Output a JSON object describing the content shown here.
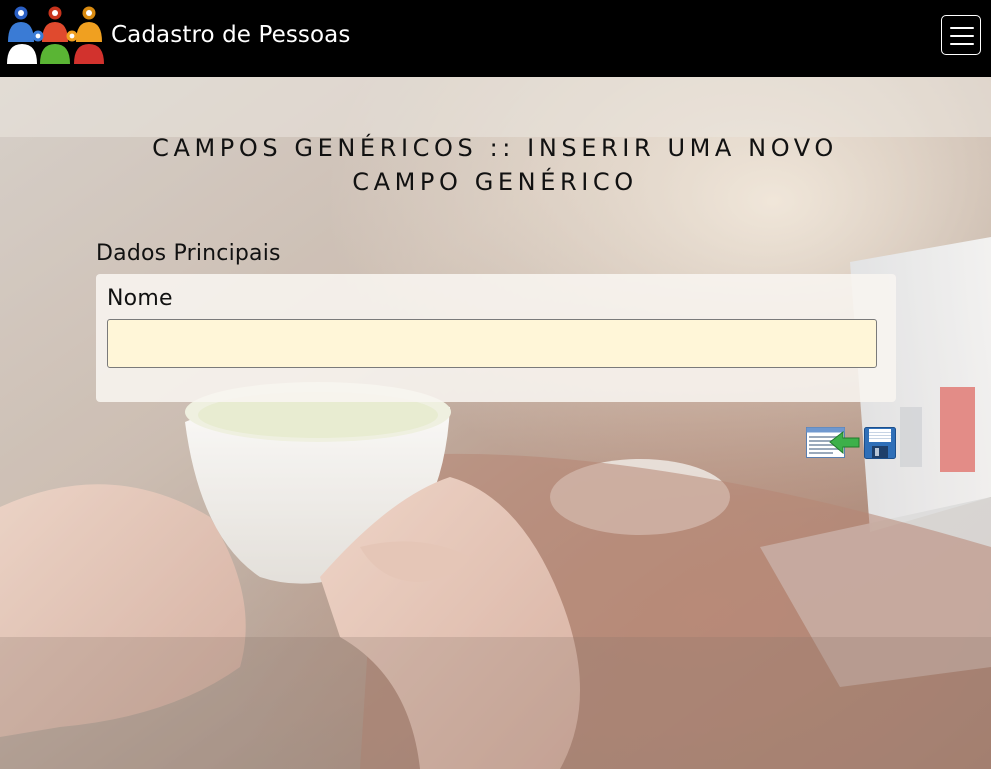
{
  "app": {
    "title": "Cadastro de Pessoas",
    "logo_icon": "people-group-logo"
  },
  "navbar": {
    "menu_toggle_icon": "hamburger-menu-icon"
  },
  "page": {
    "heading": "CAMPOS GENÉRICOS :: INSERIR UMA NOVO CAMPO GENÉRICO",
    "section_title": "Dados Principais"
  },
  "form": {
    "fields": [
      {
        "label": "Nome",
        "value": "",
        "placeholder": ""
      }
    ]
  },
  "actions": {
    "back_icon": "back-to-list-icon",
    "save_icon": "save-floppy-icon"
  },
  "colors": {
    "navbar_bg": "#000000",
    "input_bg": "#fff6d8",
    "logo_blue": "#3a7bd5",
    "logo_red": "#e04a2e",
    "logo_green": "#5ab534",
    "logo_orange": "#f0a020"
  }
}
